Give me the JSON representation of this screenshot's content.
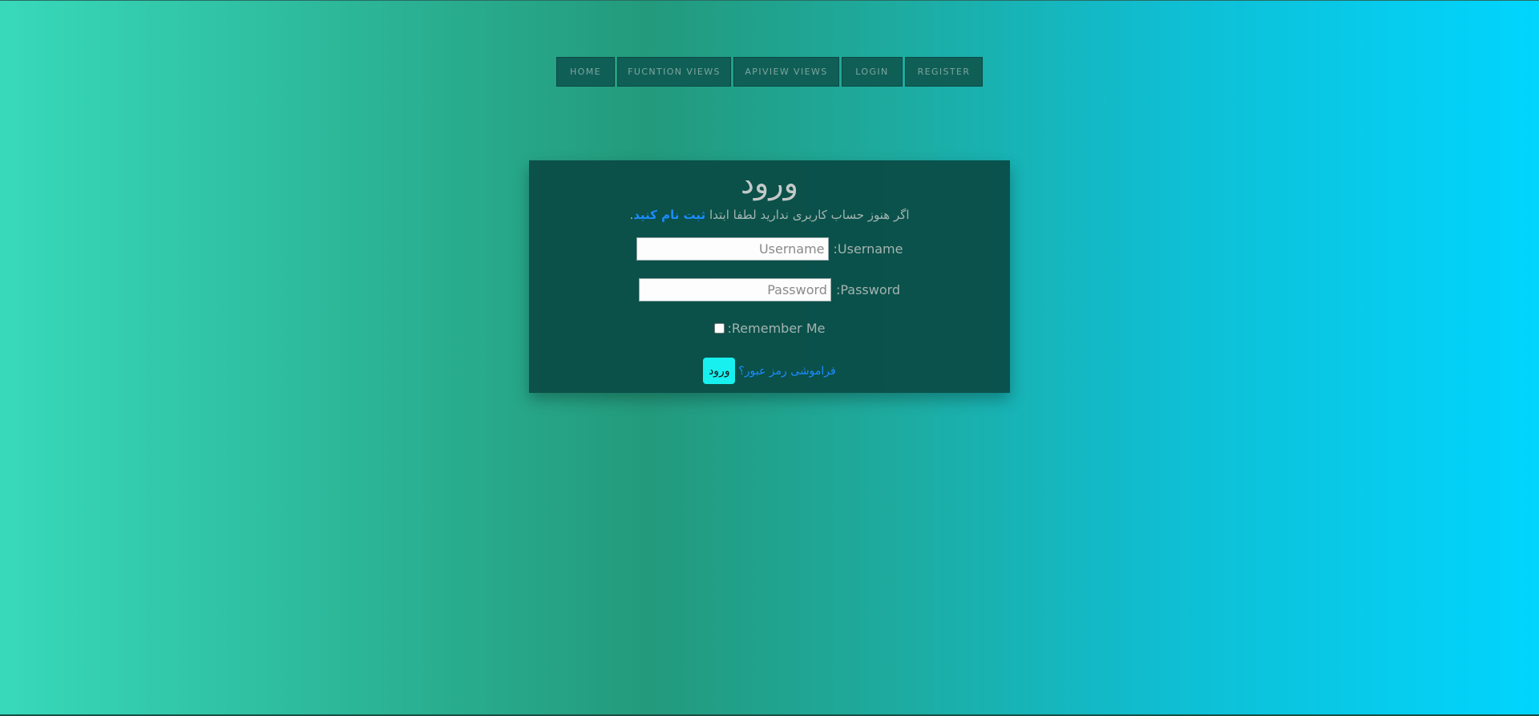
{
  "nav": {
    "items": [
      {
        "label": "HOME"
      },
      {
        "label": "FUCNTION VIEWS"
      },
      {
        "label": "APIVIEW VIEWS"
      },
      {
        "label": "LOGIN"
      },
      {
        "label": "REGISTER"
      }
    ]
  },
  "login": {
    "title": "ورود",
    "subtitle_prefix": "اگر هنوز حساب کاربری ندارید لطفا ابتدا ",
    "subtitle_link": "ثبت نام کنید",
    "subtitle_suffix": ".",
    "username_label": ":Username",
    "username_placeholder": "Username",
    "username_value": "",
    "password_label": ":Password",
    "password_placeholder": "Password",
    "password_value": "",
    "remember_label": ":Remember Me",
    "submit_label": "ورود",
    "forgot_label": "فراموشی رمز عبور؟"
  },
  "colors": {
    "gradient_left": "#38d9bb",
    "gradient_mid": "#239a7c",
    "gradient_right": "#00d5ff",
    "nav_bg": "#0f5f57",
    "card_bg": "#0a4a44",
    "link": "#1a8cff",
    "submit_bg": "#18f0f0"
  }
}
